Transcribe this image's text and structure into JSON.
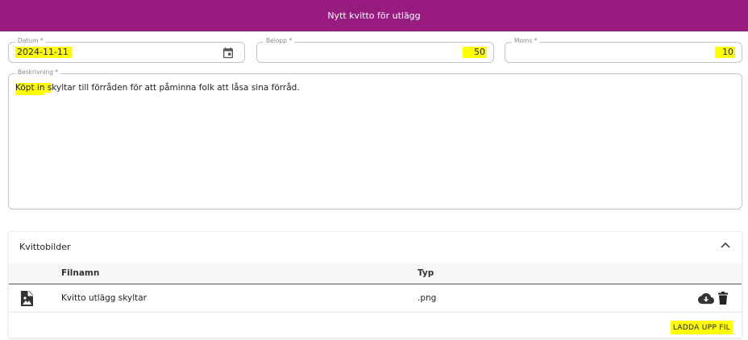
{
  "dialog": {
    "title": "Nytt kvitto för utlägg"
  },
  "form": {
    "date": {
      "label": "Datum *",
      "value": "2024-11-11"
    },
    "amount": {
      "label": "Belopp *",
      "value": "50"
    },
    "vat": {
      "label": "Moms *",
      "value": "10"
    },
    "description": {
      "label": "Beskrivning *",
      "value_highlighted": "Köpt in",
      "value_mid": " s",
      "value_rest": "kyltar till förråden för att påminna folk att låsa sina förråd."
    }
  },
  "receipts": {
    "title": "Kvittobilder",
    "columns": [
      "Filnamn",
      "Typ"
    ],
    "rows": [
      {
        "filename": "Kvitto utlägg skyltar",
        "type": ".png"
      }
    ],
    "upload_label": "LADDA UPP FIL"
  },
  "icons": {
    "calendar": "calendar-icon",
    "collapse": "chevron-up-icon",
    "file": "image-file-icon",
    "download": "cloud-download-icon",
    "delete": "trash-icon"
  },
  "colors": {
    "header": "#981b7f",
    "highlight": "#ffff00"
  }
}
